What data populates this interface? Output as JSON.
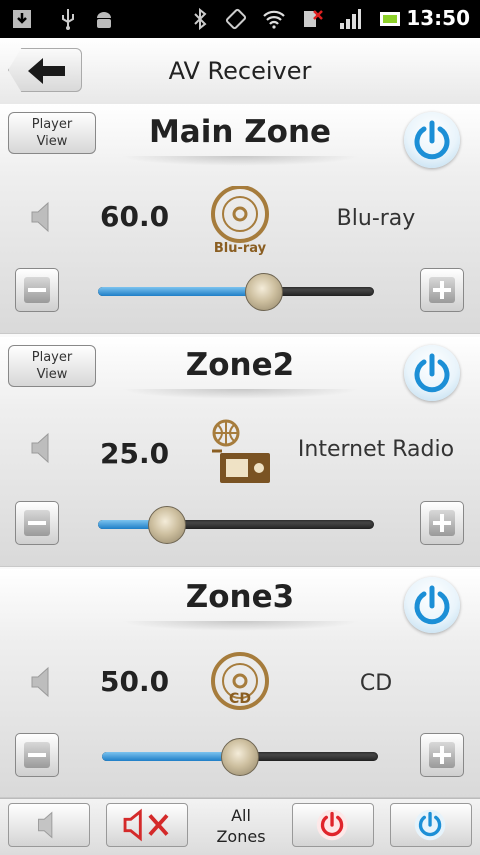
{
  "status_bar": {
    "time": "13:50",
    "icons": [
      "download-icon",
      "usb-icon",
      "android-icon",
      "bluetooth-icon",
      "rotation-icon",
      "wifi-icon",
      "sim-error-icon",
      "signal-icon",
      "battery-icon"
    ]
  },
  "header": {
    "title": "AV Receiver",
    "back_icon": "back-arrow-icon"
  },
  "zones": [
    {
      "title": "Main Zone",
      "player_view": {
        "line1": "Player",
        "line2": "View"
      },
      "volume": "60.0",
      "source": "Blu-ray",
      "source_icon_label": "Blu-ray",
      "slider_fraction": 0.6
    },
    {
      "title": "Zone2",
      "player_view": {
        "line1": "Player",
        "line2": "View"
      },
      "volume": "25.0",
      "source": "Internet Radio",
      "source_icon_label": "",
      "slider_fraction": 0.25
    },
    {
      "title": "Zone3",
      "volume": "50.0",
      "source": "CD",
      "source_icon_label": "CD",
      "slider_fraction": 0.5
    }
  ],
  "bottom_bar": {
    "all_zones_line1": "All",
    "all_zones_line2": "Zones",
    "colors": {
      "mute_red": "#d42a2a",
      "power_red": "#e0242b",
      "power_blue": "#1c8fd6"
    }
  },
  "colors": {
    "accent_blue": "#1e7ec7",
    "power_blue": "#1c8fd6"
  }
}
